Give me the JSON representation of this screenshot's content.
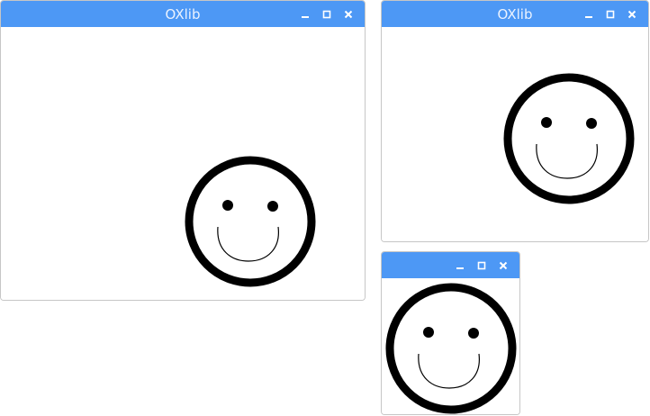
{
  "windows": [
    {
      "title": "OXlib",
      "controls": [
        "minimize-icon",
        "maximize-icon",
        "close-icon"
      ]
    },
    {
      "title": "OXlib",
      "controls": [
        "minimize-icon",
        "maximize-icon",
        "close-icon"
      ]
    },
    {
      "title": "",
      "controls": [
        "minimize-icon",
        "maximize-icon",
        "close-icon"
      ]
    }
  ],
  "colors": {
    "titlebar": "#4d98f5",
    "title_text": "#eaf2ff",
    "content_bg": "#ffffff",
    "drawing": "#000000"
  },
  "content": {
    "drawing": "smiley-face"
  }
}
